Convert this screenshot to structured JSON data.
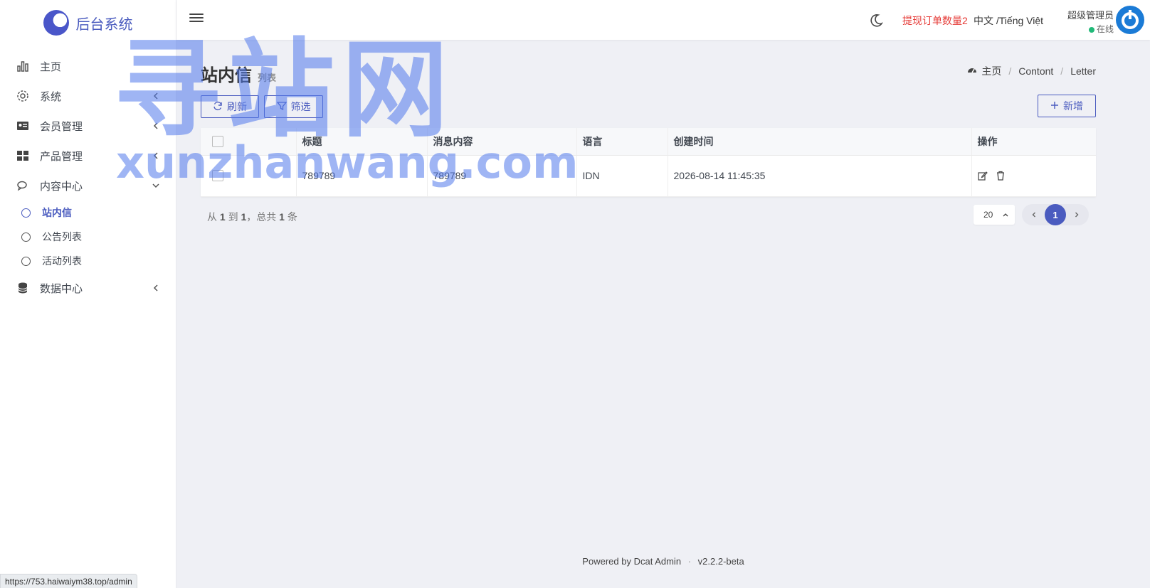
{
  "sidebar": {
    "brand": "后台系统",
    "items": [
      {
        "label": "主页",
        "icon": "bar-chart-icon"
      },
      {
        "label": "系统",
        "icon": "gear-icon"
      },
      {
        "label": "会员管理",
        "icon": "id-card-icon"
      },
      {
        "label": "产品管理",
        "icon": "grid-icon"
      },
      {
        "label": "内容中心",
        "icon": "chat-icon"
      }
    ],
    "sub_items": [
      {
        "label": "站内信",
        "active": true
      },
      {
        "label": "公告列表"
      },
      {
        "label": "活动列表"
      }
    ],
    "last_item": {
      "label": "数据中心",
      "icon": "database-icon"
    }
  },
  "topbar": {
    "withdraw_notice": "提现订单数量2",
    "language": "中文 /Tiếng Việt",
    "user_name": "超级管理员",
    "user_status": "在线"
  },
  "page": {
    "title": "站内信",
    "subtitle": "列表",
    "breadcrumb": [
      "主页",
      "Contont",
      "Letter"
    ]
  },
  "toolbar": {
    "refresh_label": "刷新",
    "filter_label": "筛选",
    "new_label": "新增"
  },
  "table": {
    "headers": [
      "标题",
      "消息内容",
      "语言",
      "创建时间",
      "操作"
    ],
    "rows": [
      {
        "title": "789789",
        "content": "789789",
        "language": "IDN",
        "created_at": "2026-08-14 11:45:35"
      }
    ]
  },
  "pagination": {
    "summary_from": "从",
    "from": "1",
    "summary_to": "到",
    "to": "1",
    "summary_total": "，总共",
    "total": "1",
    "summary_unit": "条",
    "per_page": "20",
    "current_page": "1"
  },
  "watermark": {
    "big": "寻站网",
    "small": "xunzhanwang.com"
  },
  "footer": {
    "powered": "Powered by",
    "product": "Dcat Admin",
    "version": "v2.2.2-beta"
  },
  "statusbar": {
    "url": "https://753.haiwaiym38.top/admin"
  },
  "colors": {
    "accent": "#4a5bbf",
    "danger": "#e53935",
    "online": "#21b978",
    "background": "#eff0f5"
  }
}
